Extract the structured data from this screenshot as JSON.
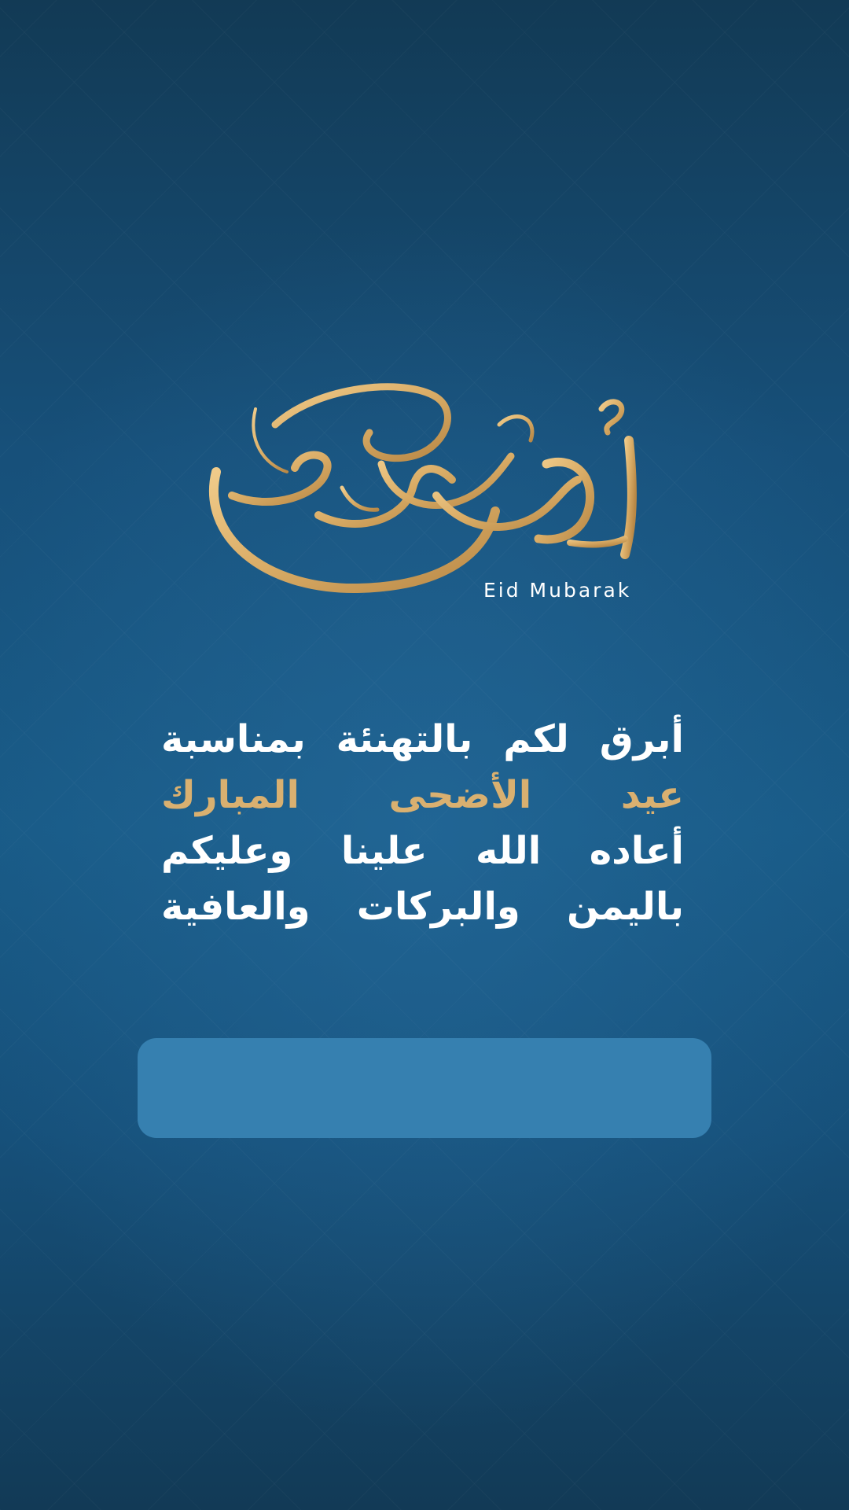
{
  "logo": {
    "icon": "eid-adha-calligraphy-logo",
    "calligraphy_text": "أضحى مبارك",
    "caption": "Eid Mubarak",
    "color": "#d9b070"
  },
  "greeting": {
    "lines": [
      "أبرق لكم بالتهنئة بمناسبة",
      "عيد الأضحى المبارك",
      "أعاده الله علينا وعليكم",
      "باليمن والبركات والعافية"
    ],
    "highlight_color": "#d9b070",
    "text_color": "#ffffff"
  },
  "blank_box": {
    "color": "#3680b0"
  }
}
